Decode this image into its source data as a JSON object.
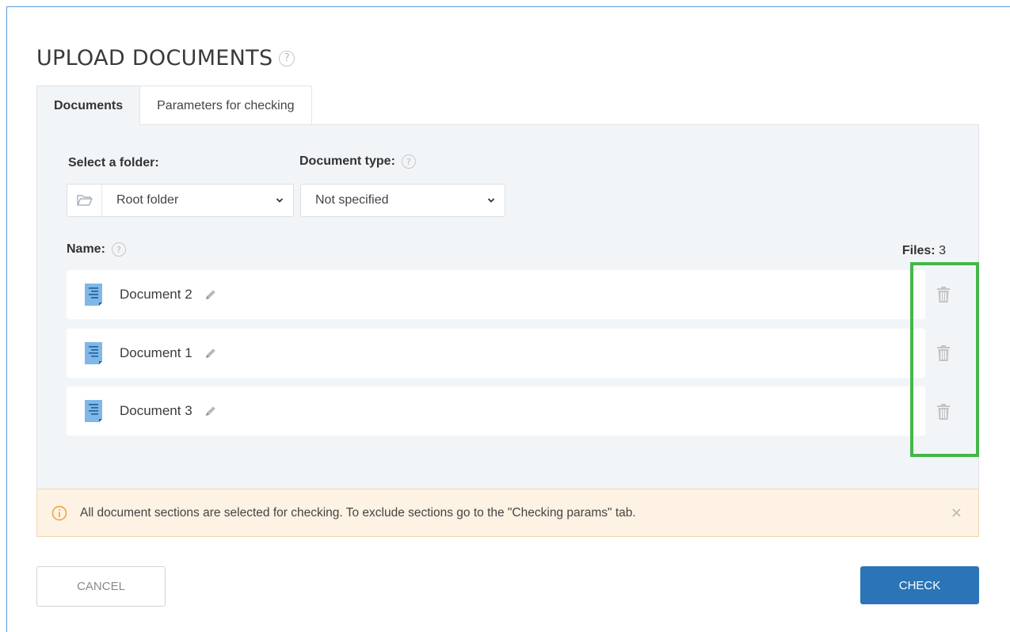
{
  "page": {
    "title": "UPLOAD DOCUMENTS",
    "help_glyph": "?"
  },
  "tabs": [
    {
      "label": "Documents",
      "active": true
    },
    {
      "label": "Parameters for checking",
      "active": false
    }
  ],
  "form": {
    "folder_label": "Select a folder:",
    "folder_value": "Root folder",
    "doctype_label": "Document type:",
    "doctype_value": "Not specified",
    "name_label": "Name:",
    "files_label": "Files:",
    "files_count": "3"
  },
  "documents": [
    {
      "name": "Document 2"
    },
    {
      "name": "Document 1"
    },
    {
      "name": "Document 3"
    }
  ],
  "notice": {
    "text": "All document sections are selected for checking. To exclude sections go to the \"Checking params\" tab.",
    "close_glyph": "×"
  },
  "buttons": {
    "cancel": "CANCEL",
    "check": "CHECK"
  },
  "icons": {
    "folder": "folder-open-icon",
    "chevron": "chevron-down-icon",
    "document": "document-icon",
    "edit": "pencil-icon",
    "delete": "trash-icon",
    "info": "info-icon"
  },
  "colors": {
    "primary": "#2b74b8",
    "highlight": "#45b649",
    "notice_bg": "#fdf2e3",
    "panel_bg": "#f2f5f8"
  }
}
